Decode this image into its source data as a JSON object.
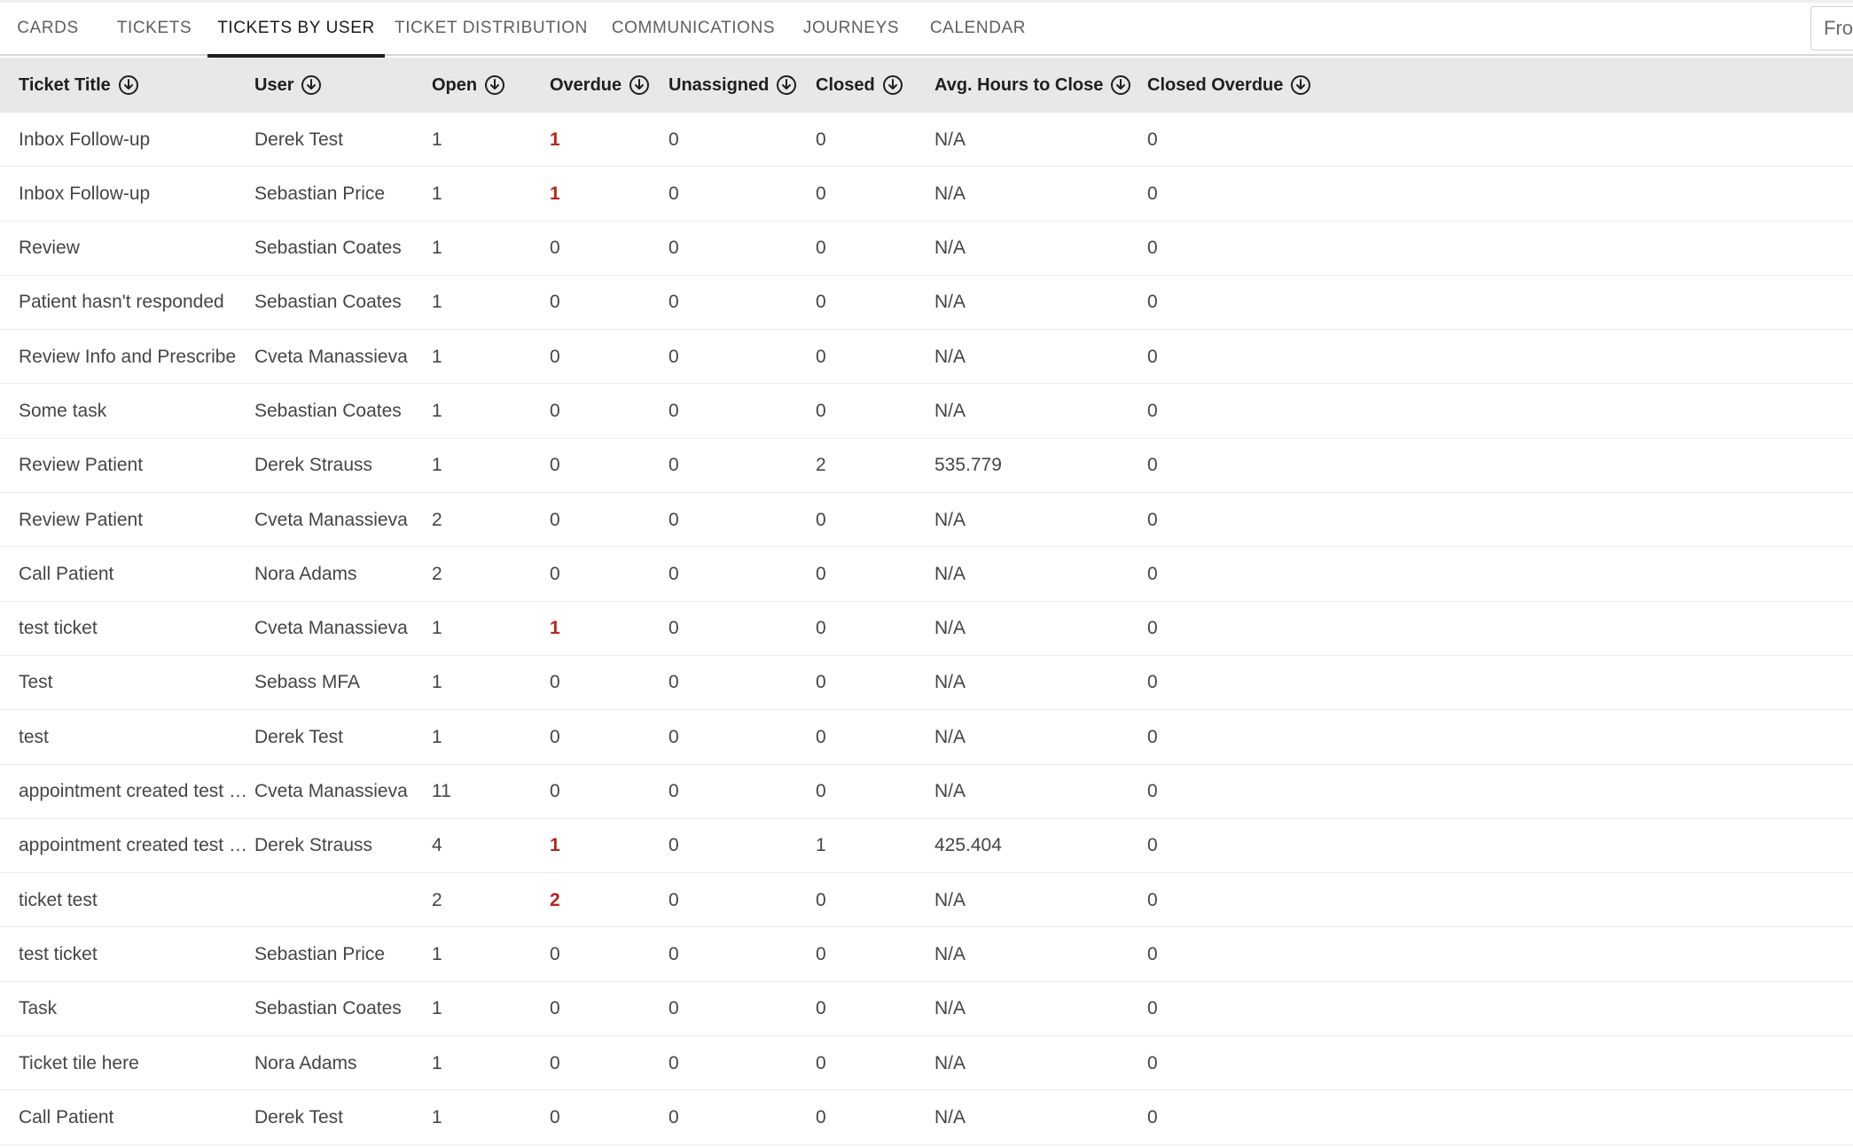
{
  "tabs": [
    {
      "label": "CARDS",
      "active": false
    },
    {
      "label": "TICKETS",
      "active": false
    },
    {
      "label": "TICKETS BY USER",
      "active": true
    },
    {
      "label": "TICKET DISTRIBUTION",
      "active": false
    },
    {
      "label": "COMMUNICATIONS",
      "active": false
    },
    {
      "label": "JOURNEYS",
      "active": false
    },
    {
      "label": "CALENDAR",
      "active": false
    }
  ],
  "date_filter": {
    "from_value": "Fro"
  },
  "table": {
    "columns": [
      "Ticket Title",
      "User",
      "Open",
      "Overdue",
      "Unassigned",
      "Closed",
      "Avg. Hours to Close",
      "Closed Overdue"
    ],
    "rows": [
      [
        "Inbox Follow-up",
        "Derek Test",
        "1",
        "1",
        "0",
        "0",
        "N/A",
        "0"
      ],
      [
        "Inbox Follow-up",
        "Sebastian Price",
        "1",
        "1",
        "0",
        "0",
        "N/A",
        "0"
      ],
      [
        "Review",
        "Sebastian Coates",
        "1",
        "0",
        "0",
        "0",
        "N/A",
        "0"
      ],
      [
        "Patient hasn't responded",
        "Sebastian Coates",
        "1",
        "0",
        "0",
        "0",
        "N/A",
        "0"
      ],
      [
        "Review Info and Prescribe",
        "Cveta Manassieva",
        "1",
        "0",
        "0",
        "0",
        "N/A",
        "0"
      ],
      [
        "Some task",
        "Sebastian Coates",
        "1",
        "0",
        "0",
        "0",
        "N/A",
        "0"
      ],
      [
        "Review Patient",
        "Derek Strauss",
        "1",
        "0",
        "0",
        "2",
        "535.779",
        "0"
      ],
      [
        "Review Patient",
        "Cveta Manassieva",
        "2",
        "0",
        "0",
        "0",
        "N/A",
        "0"
      ],
      [
        "Call Patient",
        "Nora Adams",
        "2",
        "0",
        "0",
        "0",
        "N/A",
        "0"
      ],
      [
        "test ticket",
        "Cveta Manassieva",
        "1",
        "1",
        "0",
        "0",
        "N/A",
        "0"
      ],
      [
        "Test",
        "Sebass MFA",
        "1",
        "0",
        "0",
        "0",
        "N/A",
        "0"
      ],
      [
        "test",
        "Derek Test",
        "1",
        "0",
        "0",
        "0",
        "N/A",
        "0"
      ],
      [
        "appointment created test …",
        "Cveta Manassieva",
        "11",
        "0",
        "0",
        "0",
        "N/A",
        "0"
      ],
      [
        "appointment created test …",
        "Derek Strauss",
        "4",
        "1",
        "0",
        "1",
        "425.404",
        "0"
      ],
      [
        "ticket test",
        "",
        "2",
        "2",
        "0",
        "0",
        "N/A",
        "0"
      ],
      [
        "test ticket",
        "Sebastian Price",
        "1",
        "0",
        "0",
        "0",
        "N/A",
        "0"
      ],
      [
        "Task",
        "Sebastian Coates",
        "1",
        "0",
        "0",
        "0",
        "N/A",
        "0"
      ],
      [
        "Ticket tile here",
        "Nora Adams",
        "1",
        "0",
        "0",
        "0",
        "N/A",
        "0"
      ],
      [
        "Call Patient",
        "Derek Test",
        "1",
        "0",
        "0",
        "0",
        "N/A",
        "0"
      ]
    ]
  },
  "colors": {
    "overdue_highlight": "#b3261e",
    "header_bg": "#e8e8e8",
    "active_tab_underline": "#1f1f1f"
  },
  "icons": {
    "sort": "arrow-down-circle-icon"
  }
}
